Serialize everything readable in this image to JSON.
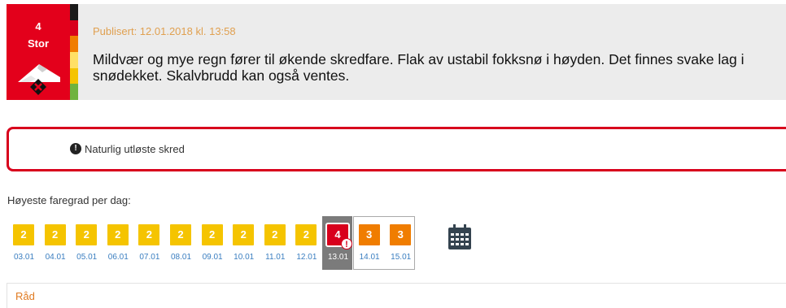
{
  "warning": {
    "level": "4",
    "level_label": "Stor",
    "published": "Publisert: 12.01.2018 kl. 13:58",
    "headline": "Mildvær og mye regn fører til økende skredfare. Flak av ustabil fokksnø i høyden. Det finnes svake lag i snødekket. Skalvbrudd kan også ventes.",
    "badge_icon": "avalanche-danger-icon",
    "scale_colors": [
      "#1a1a1a",
      "#d8001c",
      "#f07d00",
      "#ffe066",
      "#f5c400",
      "#6fb33f"
    ]
  },
  "problem": {
    "icon": "exclamation-circle-icon",
    "label": "Naturlig utløste skred"
  },
  "per_day": {
    "label": "Høyeste faregrad per dag:",
    "days": [
      {
        "level": "2",
        "date": "03.01",
        "color": "#f5c400"
      },
      {
        "level": "2",
        "date": "04.01",
        "color": "#f5c400"
      },
      {
        "level": "2",
        "date": "05.01",
        "color": "#f5c400"
      },
      {
        "level": "2",
        "date": "06.01",
        "color": "#f5c400"
      },
      {
        "level": "2",
        "date": "07.01",
        "color": "#f5c400"
      },
      {
        "level": "2",
        "date": "08.01",
        "color": "#f5c400"
      },
      {
        "level": "2",
        "date": "09.01",
        "color": "#f5c400"
      },
      {
        "level": "2",
        "date": "10.01",
        "color": "#f5c400"
      },
      {
        "level": "2",
        "date": "11.01",
        "color": "#f5c400"
      },
      {
        "level": "2",
        "date": "12.01",
        "color": "#f5c400"
      },
      {
        "level": "4",
        "date": "13.01",
        "color": "#d8001c",
        "selected": true,
        "alert": "!"
      },
      {
        "level": "3",
        "date": "14.01",
        "color": "#f07d00"
      },
      {
        "level": "3",
        "date": "15.01",
        "color": "#f07d00"
      }
    ],
    "calendar_icon": "calendar-icon"
  },
  "advice": {
    "label": "Råd"
  }
}
